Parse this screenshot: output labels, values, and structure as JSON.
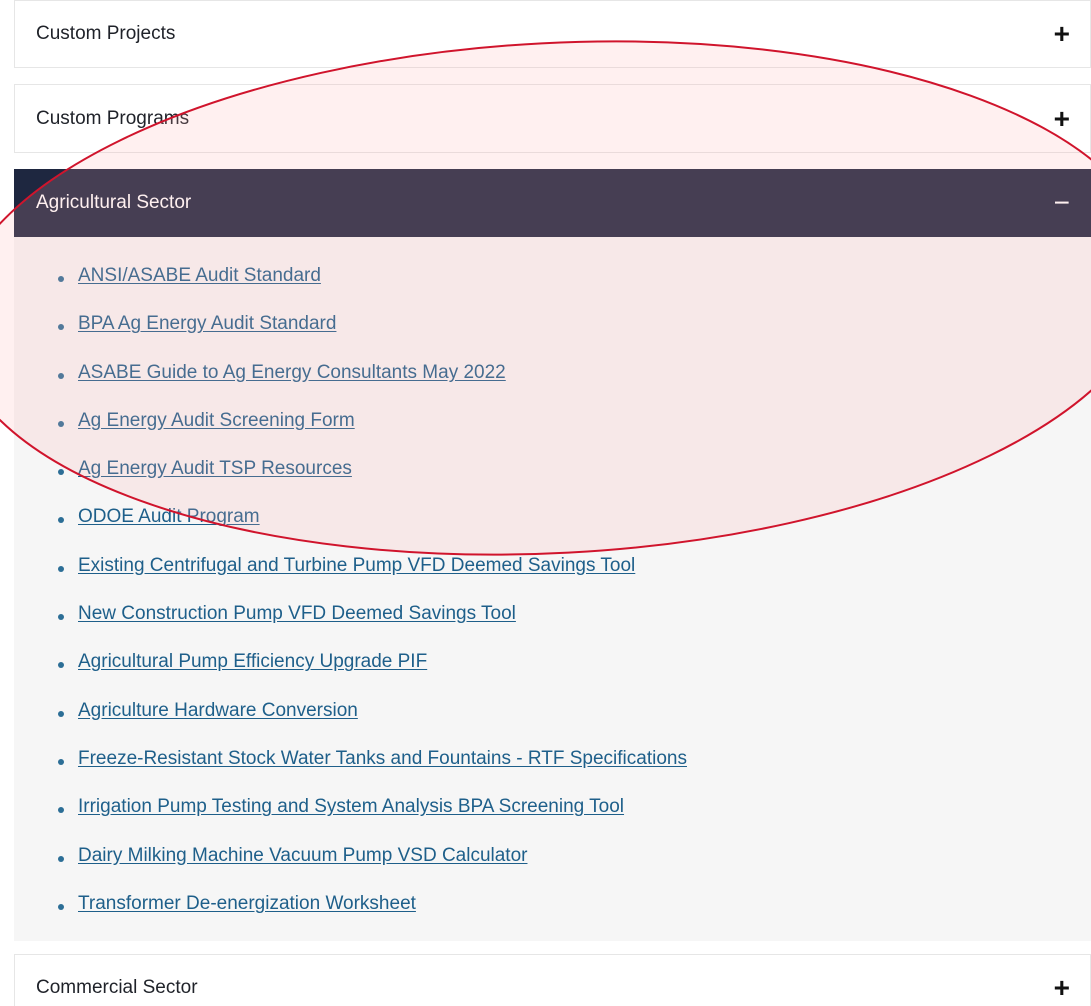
{
  "accordion": {
    "sections": [
      {
        "title": "Custom Projects",
        "toggle": "+"
      },
      {
        "title": "Custom Programs",
        "toggle": "+"
      },
      {
        "title": "Agricultural Sector",
        "toggle": "−"
      },
      {
        "title": "Commercial Sector",
        "toggle": "+"
      }
    ],
    "agricultural_links": [
      "ANSI/ASABE Audit Standard",
      "BPA Ag Energy Audit Standard",
      "ASABE Guide to Ag Energy Consultants May 2022",
      "Ag Energy Audit Screening Form",
      "Ag Energy Audit TSP Resources",
      "ODOE Audit Program",
      "Existing Centrifugal and Turbine Pump VFD Deemed Savings Tool",
      "New Construction Pump VFD Deemed Savings Tool",
      "Agricultural Pump Efficiency Upgrade PIF",
      "Agriculture Hardware Conversion",
      "Freeze-Resistant Stock Water Tanks and Fountains - RTF Specifications",
      "Irrigation Pump Testing and System Analysis BPA Screening Tool",
      "Dairy Milking Machine Vacuum Pump VSD Calculator",
      "Transformer De-energization Worksheet"
    ]
  },
  "colors": {
    "active_header_bg": "#1e2740",
    "link": "#1e5f8a",
    "panel_bg": "#f6f6f6",
    "annotation_stroke": "#d0142c",
    "annotation_fill": "rgba(255,170,170,0.18)"
  }
}
